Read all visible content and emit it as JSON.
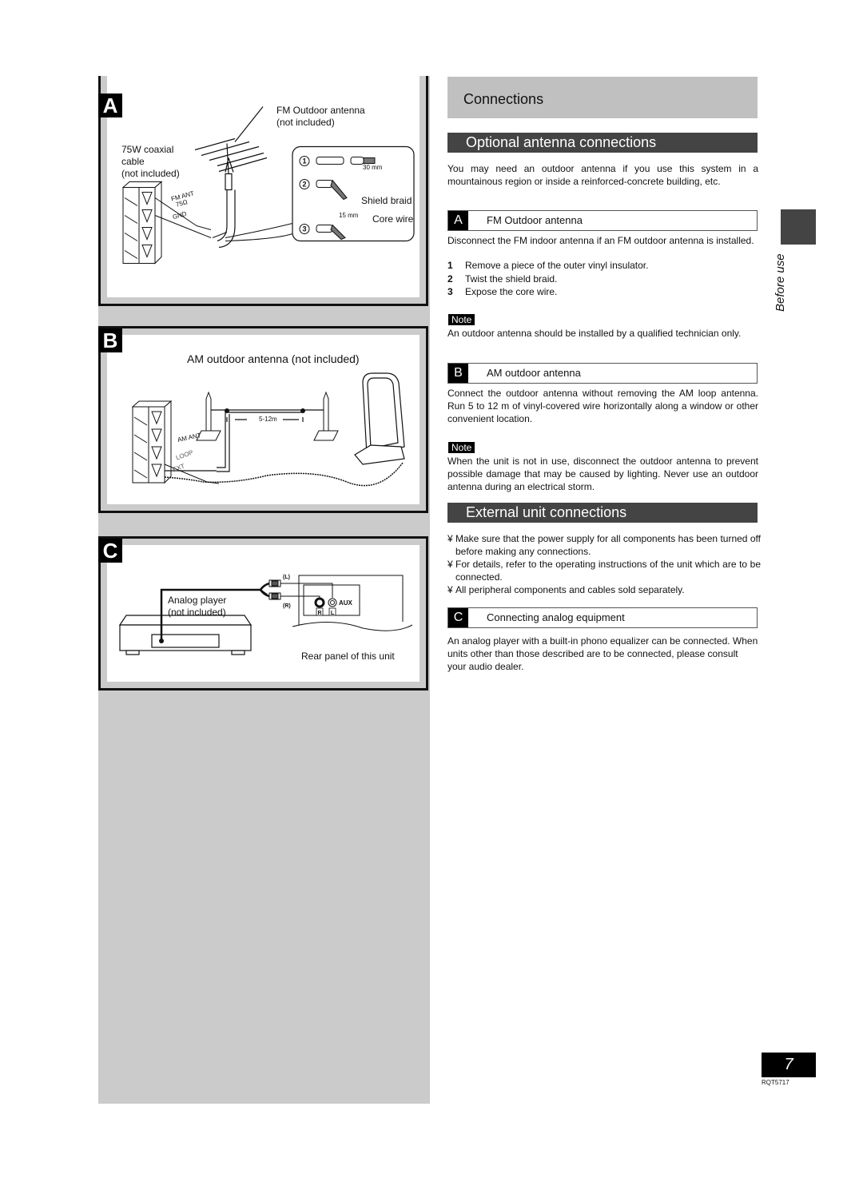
{
  "page": {
    "section_tab_label": "Before use",
    "page_number": "7",
    "doc_code": "RQT5717"
  },
  "figures": {
    "A": {
      "letter": "A",
      "fm_antenna_label_line1": "FM Outdoor antenna",
      "fm_antenna_label_line2": "(not included)",
      "coax_label_line1": "75W coaxial",
      "coax_label_line2": "cable",
      "coax_label_line3": "(not included)",
      "terminal_fm": "FM ANT",
      "terminal_ohm": "75Ω",
      "terminal_gnd": "GND",
      "steps_markers": [
        "1",
        "2",
        "3"
      ],
      "dim_30": "30 mm",
      "dim_15": "15 mm",
      "shield_braid": "Shield braid",
      "core_wire": "Core wire"
    },
    "B": {
      "letter": "B",
      "title": "AM outdoor antenna (not included)",
      "terminal_am": "AM ANT",
      "terminal_loop": "LOOP",
      "terminal_ext": "EXT",
      "distance": "5-12m"
    },
    "C": {
      "letter": "C",
      "player_label_line1": "Analog player",
      "player_label_line2": "(not included)",
      "plug_L": "(L)",
      "plug_R": "(R)",
      "jack_label": "AUX",
      "jack_R": "R",
      "jack_L": "L",
      "rear_panel_label": "Rear panel of this unit"
    }
  },
  "content": {
    "header": "Connections",
    "antenna_section": {
      "title": "Optional antenna connections",
      "intro": "You may need an outdoor antenna if you use this system in a mountainous region or inside a reinforced-concrete building, etc.",
      "fm": {
        "letter": "A",
        "title": "FM Outdoor antenna",
        "text": "Disconnect the FM indoor antenna if an FM outdoor antenna is installed.",
        "steps": [
          {
            "n": "1",
            "text": "Remove a piece of the outer vinyl insulator."
          },
          {
            "n": "2",
            "text": "Twist the shield braid."
          },
          {
            "n": "3",
            "text": "Expose the core wire."
          }
        ],
        "note_label": "Note",
        "note": "An outdoor antenna should be installed by a qualified technician only."
      },
      "am": {
        "letter": "B",
        "title": "AM outdoor antenna",
        "text": "Connect the outdoor antenna without removing the AM loop antenna. Run 5 to 12 m of vinyl-covered wire horizontally along a window or other convenient location.",
        "note_label": "Note",
        "note": "When the unit is not in use, disconnect the outdoor antenna to prevent possible damage that may be caused by lighting.  Never use an outdoor antenna during an electrical storm."
      }
    },
    "external_section": {
      "title": "External unit connections",
      "bullet_mark": "¥",
      "bullets": [
        "Make sure that the power supply for all components has been turned off before making any connections.",
        "For details, refer to the operating instructions of the unit which are to be connected.",
        "All peripheral components and cables sold separately."
      ],
      "analog": {
        "letter": "C",
        "title": "Connecting analog equipment",
        "text": "An analog player with a built-in phono equalizer can be connected. When units other than those described are to be connected, please consult your audio dealer."
      }
    }
  }
}
